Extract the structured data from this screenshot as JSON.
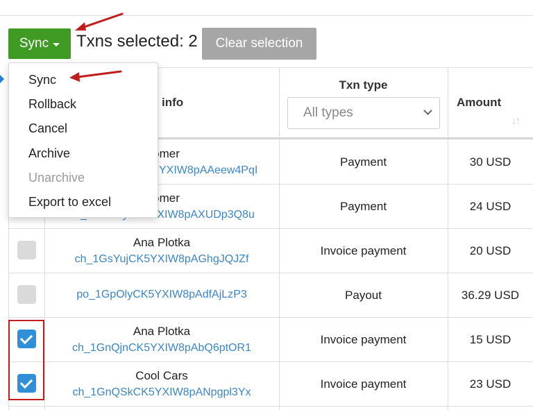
{
  "toolbar": {
    "sync_label": "Sync",
    "selected_text": "Txns selected: 2",
    "clear_label": "Clear selection"
  },
  "headers": {
    "info": "info",
    "txn_type": "Txn type",
    "amount": "Amount",
    "type_filter_value": "All types"
  },
  "menu": {
    "items": [
      {
        "label": "Sync",
        "enabled": true
      },
      {
        "label": "Rollback",
        "enabled": true
      },
      {
        "label": "Cancel",
        "enabled": true
      },
      {
        "label": "Archive",
        "enabled": true
      },
      {
        "label": "Unarchive",
        "enabled": false
      },
      {
        "label": "Export to excel",
        "enabled": true
      }
    ]
  },
  "rows": [
    {
      "name": "customer",
      "id": "YXIW8pAAeew4PqI",
      "type": "Payment",
      "amount": "30 USD",
      "checked": false
    },
    {
      "name": "customer",
      "id": "ch_1GYKoyCK5YXIW8pAXUDp3Q8u",
      "type": "Payment",
      "amount": "24 USD",
      "checked": false
    },
    {
      "name": "Ana Plotka",
      "id": "ch_1GsYujCK5YXIW8pAGhgJQJZf",
      "type": "Invoice payment",
      "amount": "20 USD",
      "checked": false
    },
    {
      "name": "",
      "id": "po_1GpOlyCK5YXIW8pAdfAjLzP3",
      "type": "Payout",
      "amount": "36.29 USD",
      "checked": false
    },
    {
      "name": "Ana Plotka",
      "id": "ch_1GnQjnCK5YXIW8pAbQ6ptOR1",
      "type": "Invoice payment",
      "amount": "15 USD",
      "checked": true
    },
    {
      "name": "Cool Cars",
      "id": "ch_1GnQSkCK5YXIW8pANpgpl3Yx",
      "type": "Invoice payment",
      "amount": "23 USD",
      "checked": true
    }
  ],
  "colors": {
    "sync_green": "#3f9b23",
    "clear_gray": "#a6a6a6",
    "link_blue": "#3b86c4",
    "check_blue": "#2f8fd8",
    "annotation_red": "#c11d1d"
  }
}
